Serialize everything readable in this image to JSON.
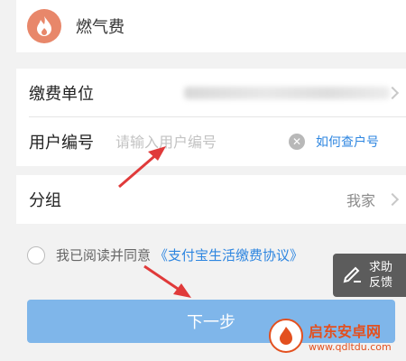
{
  "header": {
    "title": "燃气费",
    "logo_icon": "flame-icon"
  },
  "form": {
    "payee_label": "缴费单位",
    "user_id_label": "用户编号",
    "user_id_placeholder": "请输入用户编号",
    "user_id_value": "",
    "lookup_link": "如何查户号",
    "group_label": "分组",
    "group_value": "我家"
  },
  "agreement": {
    "text": "我已阅读并同意",
    "link": "《支付宝生活缴费协议》"
  },
  "next_button": "下一步",
  "feedback": {
    "line1": "求助",
    "line2": "反馈"
  },
  "watermark": {
    "main": "启东安卓网",
    "sub": "www.qdltdu.com"
  },
  "colors": {
    "accent_link": "#2e86e0",
    "button_bg": "#7fb6ea",
    "logo_bg": "#e8876a",
    "annotation_arrow": "#e03a3a"
  }
}
